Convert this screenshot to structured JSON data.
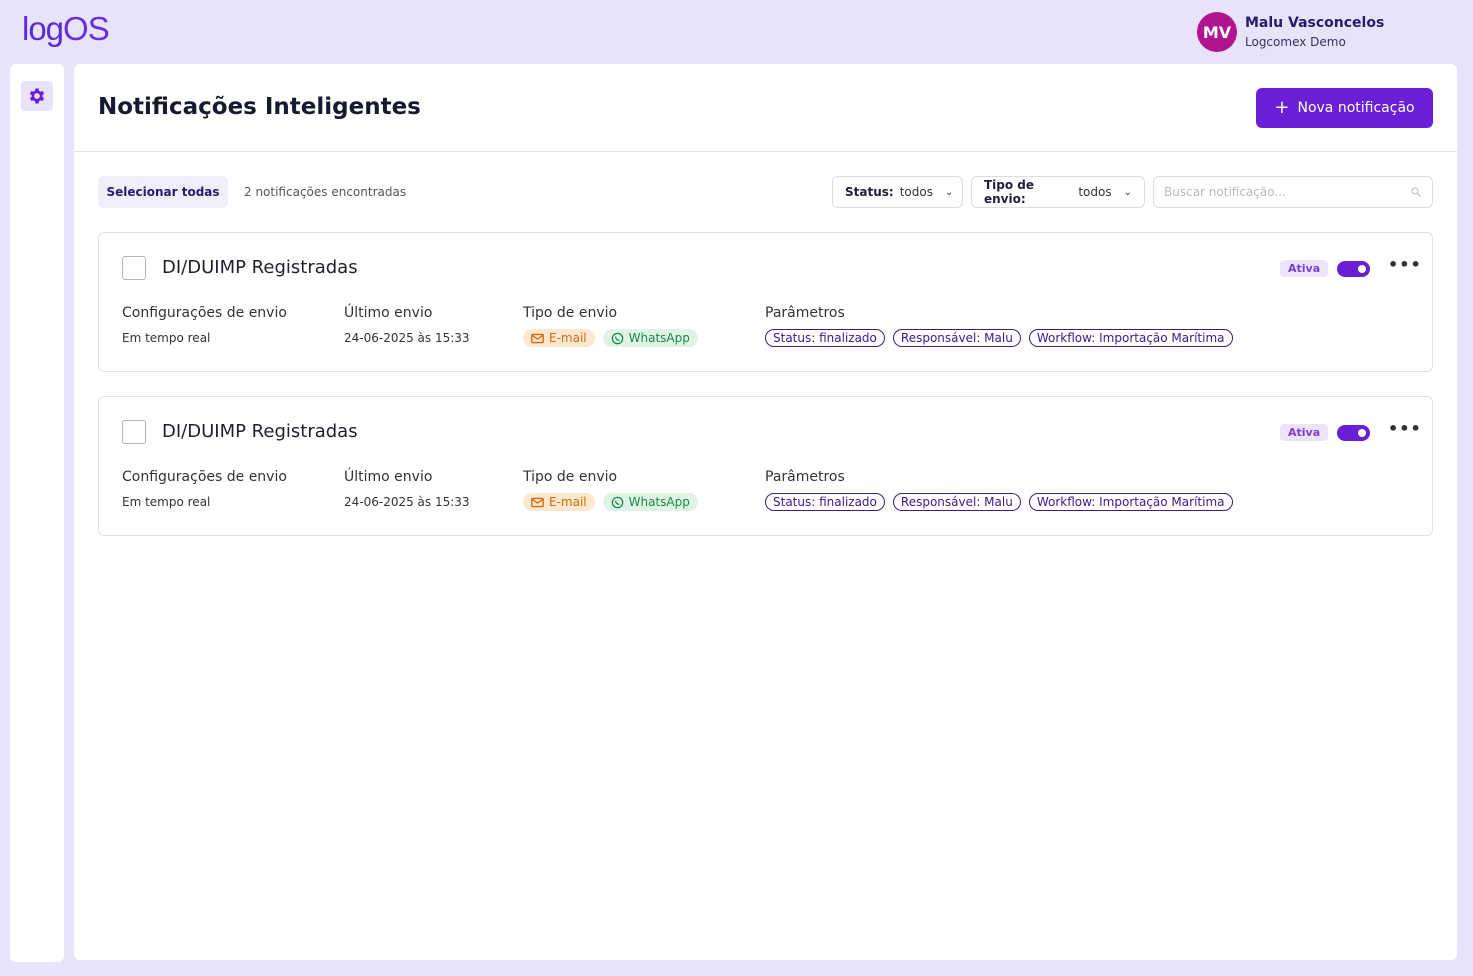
{
  "app": {
    "logo_log": "log",
    "logo_os": "OS"
  },
  "user": {
    "initials": "MV",
    "name": "Malu Vasconcelos",
    "org": "Logcomex Demo"
  },
  "page": {
    "title": "Notificações Inteligentes",
    "new_button": "Nova notificação"
  },
  "toolbar": {
    "select_all": "Selecionar todas",
    "count": "2 notificações encontradas",
    "status_label": "Status:",
    "status_value": "todos",
    "tipo_label": "Tipo de envio:",
    "tipo_value": "todos",
    "search_placeholder": "Buscar notificação..."
  },
  "columns": {
    "config": "Configurações de envio",
    "last": "Último envio",
    "tipo": "Tipo de envio",
    "params": "Parâmetros"
  },
  "notifications": [
    {
      "title": "DI/DUIMP Registradas",
      "status": "Ativa",
      "config": "Em tempo real",
      "last": "24-06-2025 às 15:33",
      "channels": [
        "E-mail",
        "WhatsApp"
      ],
      "params": [
        "Status: finalizado",
        "Responsável: Malu",
        "Workflow: Importação Marítima"
      ]
    },
    {
      "title": "DI/DUIMP Registradas",
      "status": "Ativa",
      "config": "Em tempo real",
      "last": "24-06-2025 às 15:33",
      "channels": [
        "E-mail",
        "WhatsApp"
      ],
      "params": [
        "Status: finalizado",
        "Responsável: Malu",
        "Workflow: Importação Marítima"
      ]
    }
  ],
  "colors": {
    "accent": "#6a1ed6",
    "avatar": "#b0148f",
    "email": "#d46a0c",
    "whatsapp": "#1a8a4a"
  }
}
